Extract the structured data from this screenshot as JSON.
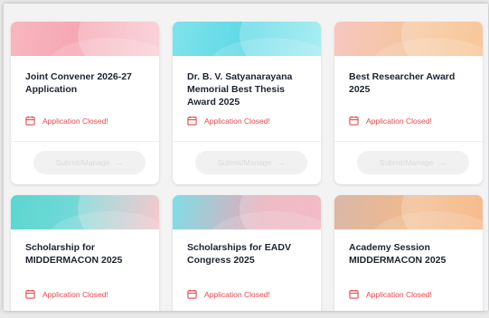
{
  "cards": [
    {
      "title": "Joint Convener 2026-27 Application",
      "status": "Application Closed!",
      "button": "Submit/Manage",
      "arrow": "→"
    },
    {
      "title": "Dr. B. V. Satyanarayana Memorial Best Thesis Award 2025",
      "status": "Application Closed!",
      "button": "Submit/Manage",
      "arrow": "→"
    },
    {
      "title": "Best Researcher Award 2025",
      "status": "Application Closed!",
      "button": "Submit/Manage",
      "arrow": "→"
    },
    {
      "title": "Scholarship for MIDDERMACON 2025",
      "status": "Application Closed!"
    },
    {
      "title": "Scholarships for EADV Congress 2025",
      "status": "Application Closed!"
    },
    {
      "title": "Academy Session MIDDERMACON 2025",
      "status": "Application Closed!"
    }
  ],
  "colors": {
    "status": "#e5484d",
    "title": "#1d2330",
    "button_disabled_bg": "#f1f1f2",
    "button_disabled_text": "#d9d9db"
  }
}
